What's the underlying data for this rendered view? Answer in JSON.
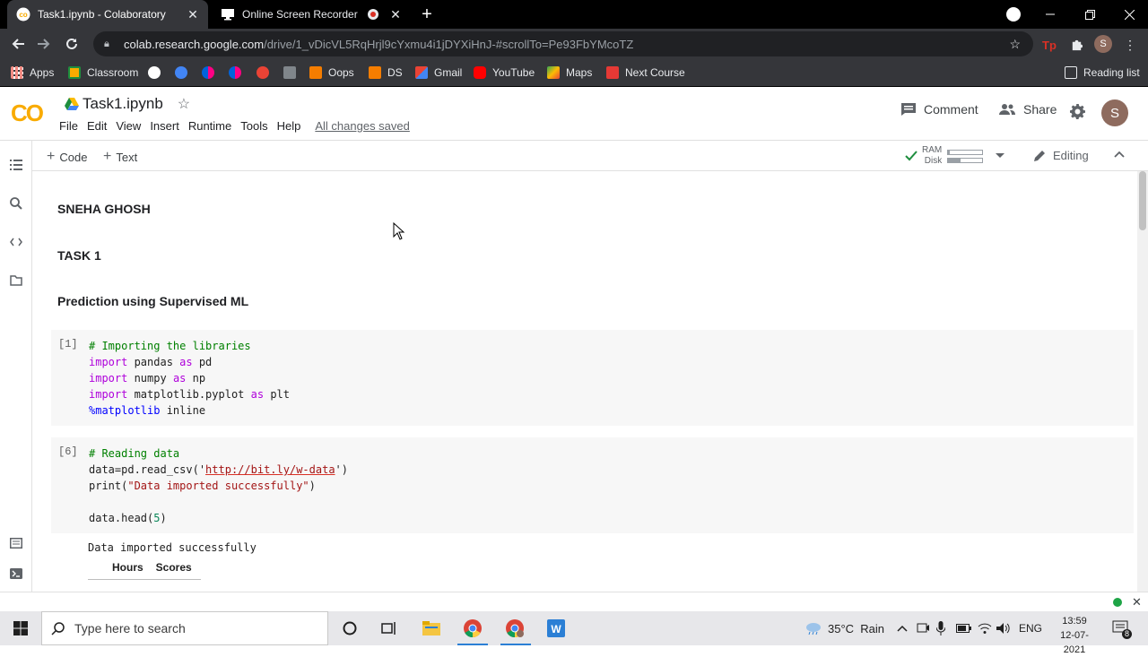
{
  "browser": {
    "tabs": [
      {
        "title": "Task1.ipynb - Colaboratory",
        "active": true
      },
      {
        "title": "Online Screen Recorder",
        "active": false
      }
    ],
    "url_host": "colab.research.google.com",
    "url_path": "/drive/1_vDicVL5RqHrjl9cYxmu4i1jDYXiHnJ-#scrollTo=Pe93FbYMcoTZ",
    "profile_initial": "S",
    "bookmarks": [
      {
        "label": "Apps",
        "icon": "apps-grid-icon",
        "color": "#e8eaed"
      },
      {
        "label": "Classroom",
        "icon": "classroom-icon",
        "color": "#f9ab00"
      },
      {
        "label": "",
        "icon": "google-icon",
        "color": "#ffffff"
      },
      {
        "label": "",
        "icon": "meet-icon",
        "color": "#4285f4"
      },
      {
        "label": "",
        "icon": "bookmark-pink-icon",
        "color": "#ff1b8d"
      },
      {
        "label": "",
        "icon": "bookmark-pink-icon",
        "color": "#ff1b8d"
      },
      {
        "label": "",
        "icon": "zoho-icon",
        "color": "#ea4335"
      },
      {
        "label": "",
        "icon": "sheet-icon",
        "color": "#5f6368"
      },
      {
        "label": "Oops",
        "icon": "blogger-icon",
        "color": "#f57d00"
      },
      {
        "label": "DS",
        "icon": "blogger-icon",
        "color": "#f57d00"
      },
      {
        "label": "Gmail",
        "icon": "gmail-icon",
        "color": "#ea4335"
      },
      {
        "label": "YouTube",
        "icon": "youtube-icon",
        "color": "#ff0000"
      },
      {
        "label": "Maps",
        "icon": "maps-icon",
        "color": "#34a853"
      },
      {
        "label": "Next Course",
        "icon": "course-icon",
        "color": "#e53935"
      }
    ],
    "reading_list": "Reading list"
  },
  "colab": {
    "notebook_title": "Task1.ipynb",
    "menu": [
      "File",
      "Edit",
      "View",
      "Insert",
      "Runtime",
      "Tools",
      "Help"
    ],
    "save_status": "All changes saved",
    "comment_label": "Comment",
    "share_label": "Share",
    "avatar_initial": "S",
    "add_code": "Code",
    "add_text": "Text",
    "ram_label": "RAM",
    "disk_label": "Disk",
    "ram_fraction": 0.05,
    "disk_fraction": 0.35,
    "editing_label": "Editing"
  },
  "notebook": {
    "headings": [
      "SNEHA GHOSH",
      "TASK 1",
      "Prediction using Supervised ML"
    ],
    "cell1": {
      "exec": "[1]",
      "comment": "# Importing the libraries",
      "l2_kw": "import",
      "l2_mod": " pandas ",
      "l2_as": "as",
      "l2_alias": " pd",
      "l3_kw": "import",
      "l3_mod": " numpy ",
      "l3_as": "as",
      "l3_alias": " np",
      "l4_kw": "import",
      "l4_mod": " matplotlib.pyplot ",
      "l4_as": "as",
      "l4_alias": " plt",
      "l5_magic": "%matplotlib",
      "l5_rest": " inline"
    },
    "cell2": {
      "exec": "[6]",
      "comment": "# Reading data",
      "l2_pre": "data=pd.read_csv('",
      "l2_url": "http://bit.ly/w-data",
      "l2_post": "')",
      "l3_pre": "print(",
      "l3_str": "\"Data imported successfully\"",
      "l3_post": ")",
      "l5_pre": "data.head(",
      "l5_num": "5",
      "l5_post": ")"
    },
    "output_text": "Data imported successfully",
    "df_columns": [
      "Hours",
      "Scores"
    ]
  },
  "taskbar": {
    "search_placeholder": "Type here to search",
    "weather": "35°C  Rain",
    "lang": "ENG",
    "time": "13:59",
    "date": "12-07-2021",
    "notifications": "8"
  }
}
